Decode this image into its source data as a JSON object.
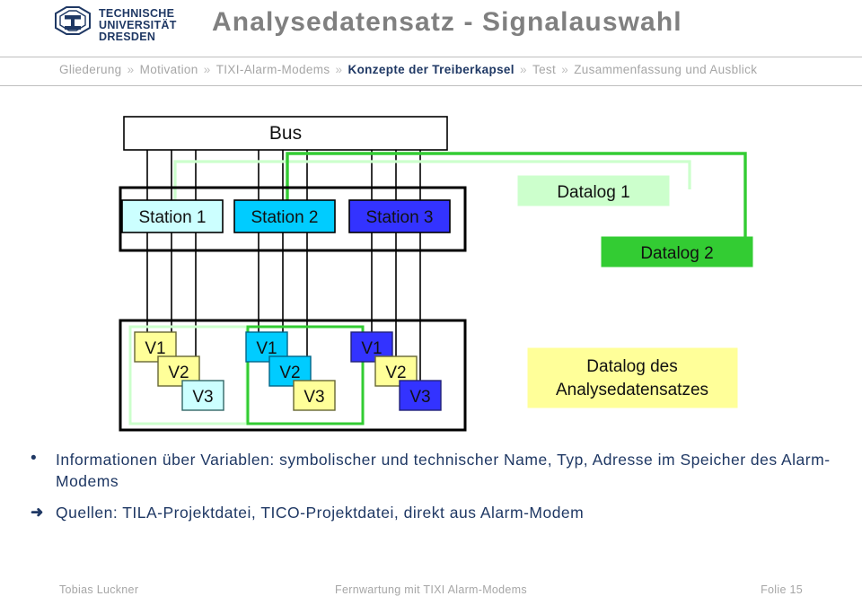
{
  "header": {
    "logo_alt": "Technische Universität Dresden",
    "logo_lines": [
      "TECHNISCHE",
      "UNIVERSITÄT",
      "DRESDEN"
    ],
    "title": "Analysedatensatz - Signalauswahl",
    "title_color": "#808080"
  },
  "breadcrumb": {
    "separator": "»",
    "items": [
      {
        "label": "Gliederung",
        "active": false
      },
      {
        "label": "Motivation",
        "active": false
      },
      {
        "label": "TIXI-Alarm-Modems",
        "active": false
      },
      {
        "label": "Konzepte der Treiberkapsel",
        "active": true
      },
      {
        "label": "Test",
        "active": false
      },
      {
        "label": "Zusammenfassung und Ausblick",
        "active": false
      }
    ]
  },
  "diagram": {
    "bus_label": "Bus",
    "stations": [
      {
        "label": "Station 1",
        "fill": "#CCFFFF"
      },
      {
        "label": "Station 2",
        "fill": "#00CCFF"
      },
      {
        "label": "Station 3",
        "fill": "#3333FF"
      }
    ],
    "datalogs": [
      {
        "label": "Datalog 1",
        "fill": "#CCFFCC",
        "stroke": "#CCFFCC"
      },
      {
        "label": "Datalog 2",
        "fill": "#33CC33",
        "stroke": "#33CC33"
      }
    ],
    "analysis_box": {
      "line1": "Datalog des",
      "line2": "Analysedatensatzes",
      "fill": "#FFFF99"
    },
    "variable_groups": [
      {
        "group_outline": "#CCFFCC",
        "variables": [
          {
            "label": "V1",
            "fill": "#FFFF99"
          },
          {
            "label": "V2",
            "fill": "#FFFF99"
          },
          {
            "label": "V3",
            "fill": "#CCFFFF"
          }
        ]
      },
      {
        "group_outline": "#33CC33",
        "variables": [
          {
            "label": "V1",
            "fill": "#00CCFF"
          },
          {
            "label": "V2",
            "fill": "#00CCFF"
          },
          {
            "label": "V3",
            "fill": "#FFFF99"
          }
        ]
      },
      {
        "group_outline": "none",
        "variables": [
          {
            "label": "V1",
            "fill": "#3333FF"
          },
          {
            "label": "V2",
            "fill": "#FFFF99"
          },
          {
            "label": "V3",
            "fill": "#3333FF"
          }
        ]
      }
    ],
    "arrows": [
      {
        "name": "datalog-1-arrow",
        "color": "#CCFFCC",
        "target": "Station 1"
      },
      {
        "name": "datalog-2-arrow",
        "color": "#33CC33",
        "target": "Station 2"
      }
    ]
  },
  "bullets": [
    {
      "marker": "•",
      "text": "Informationen über Variablen: symbolischer und technischer Name, Typ, Adresse im Speicher des Alarm-Modems"
    },
    {
      "marker": "➜",
      "text": "Quellen: TILA-Projektdatei, TICO-Projektdatei, direkt aus Alarm-Modem"
    }
  ],
  "footer": {
    "author": "Tobias Luckner",
    "center": "Fernwartung mit TIXI Alarm-Modems",
    "page": "Folie 15"
  }
}
